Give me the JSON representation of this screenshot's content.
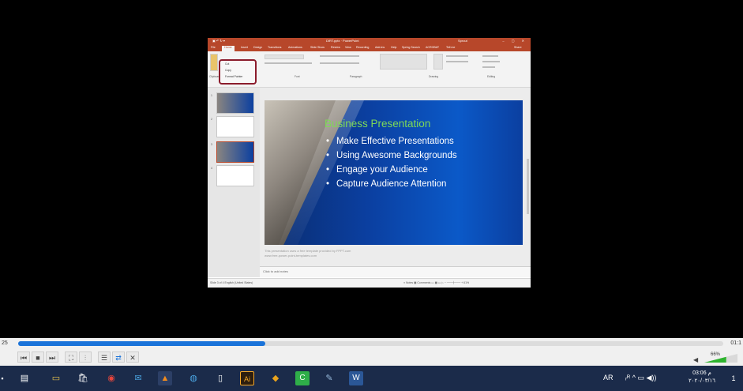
{
  "powerpoint": {
    "window_title": "DIRT.pptx · PowerPoint",
    "quick_access": "▣ ↶ ↻ ▾",
    "user": "Sprout",
    "window_buttons": "– ▢ ✕",
    "tabs": [
      "File",
      "Home",
      "Insert",
      "Design",
      "Transitions",
      "Animations",
      "Slide Show",
      "Review",
      "View",
      "Recording",
      "Add-ins",
      "Help",
      "Spring Search",
      "ACROBAT",
      "Tell me",
      "Share"
    ],
    "ribbon_groups": [
      "Clipboard",
      "Font",
      "Paragraph",
      "Drawing",
      "Editing"
    ],
    "clipboard_menu": [
      "Cut",
      "Copy",
      "Format Painter"
    ],
    "slide_numbers": [
      "1",
      "2",
      "3",
      "4"
    ],
    "slide": {
      "title": "Business Presentation",
      "bullets": [
        "Make Effective Presentations",
        "Using Awesome Backgrounds",
        "Engage your Audience",
        "Capture Audience Attention"
      ]
    },
    "notes_lines": [
      "This presentation uses a free template provided by FPPT.com",
      "www.free-power-point-templates.com"
    ],
    "notes_placeholder": "Click to add notes",
    "status_left": "Slide 3 of 4    English (United States)",
    "status_right": "≡ Notes   ▦ Comments   ▭ ▦ ▭ ▷   − ───┼─── +   61%"
  },
  "player": {
    "time_elapsed": "25",
    "time_total": "01:1",
    "progress": 0.35,
    "volume": "66%",
    "buttons": [
      "⏮",
      "■",
      "⏭",
      "⛶",
      "⫶",
      "☰",
      "⇄",
      "✕"
    ]
  },
  "taskbar": {
    "icons": [
      "▤",
      "▭",
      "🛍",
      "◉",
      "✉",
      "▲",
      "◍",
      "▯",
      "Ai",
      "◆",
      "C",
      "✎",
      "W"
    ],
    "lang": "AR",
    "tray_icons": "ᵣᴿ  ^  ▭  ◀))",
    "clock_time": "03:06 م",
    "clock_date": "٢٠٢٠/٠٣/١٦",
    "notif": "1"
  }
}
